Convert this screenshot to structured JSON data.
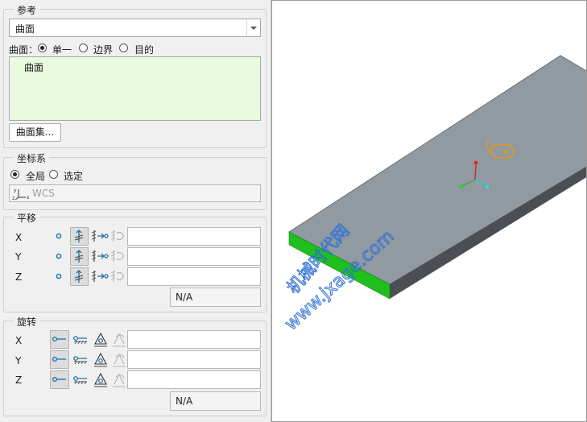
{
  "reference": {
    "title": "参考",
    "dropdown_value": "曲面",
    "surface_label": "曲面：",
    "options": [
      "单一",
      "边界",
      "目的"
    ],
    "selected_option": "单一",
    "list_items": [
      "曲面"
    ],
    "surface_set_button": "曲面集..."
  },
  "coordinate_system": {
    "title": "坐标系",
    "options": [
      "全局",
      "选定"
    ],
    "selected_option": "全局",
    "field_value": "WCS"
  },
  "translation": {
    "title": "平移",
    "axes": [
      "X",
      "Y",
      "Z"
    ],
    "status_value": "N/A"
  },
  "rotation": {
    "title": "旋转",
    "axes": [
      "X",
      "Y",
      "Z"
    ],
    "status_value": "N/A"
  },
  "viewport": {
    "watermark_lines": [
      "机械时代网",
      "www.jxage.com"
    ],
    "colors": {
      "plate_top": "#909aa0",
      "plate_side": "#4b4f53",
      "highlight_edge": "#1fbf1f",
      "tag": "#e59a17",
      "watermark": "#2f6fd6"
    }
  }
}
